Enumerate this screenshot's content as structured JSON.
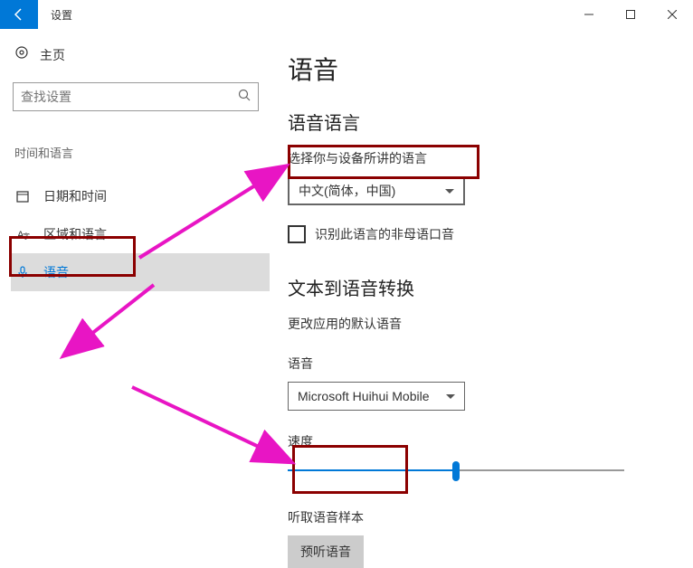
{
  "window": {
    "title": "设置"
  },
  "sidebar": {
    "home_label": "主页",
    "search_placeholder": "查找设置",
    "category_label": "时间和语言",
    "items": [
      {
        "label": "日期和时间"
      },
      {
        "label": "区域和语言"
      },
      {
        "label": "语音"
      }
    ]
  },
  "main": {
    "page_title": "语音",
    "speech_lang": {
      "section_title": "语音语言",
      "field_label": "选择你与设备所讲的语言",
      "selected": "中文(简体，中国)",
      "checkbox_label": "识别此语言的非母语口音"
    },
    "tts": {
      "section_title": "文本到语音转换",
      "desc": "更改应用的默认语音",
      "voice_label": "语音",
      "voice_selected": "Microsoft Huihui Mobile",
      "speed_label": "速度",
      "sample_label": "听取语音样本",
      "preview_button": "预听语音"
    }
  }
}
